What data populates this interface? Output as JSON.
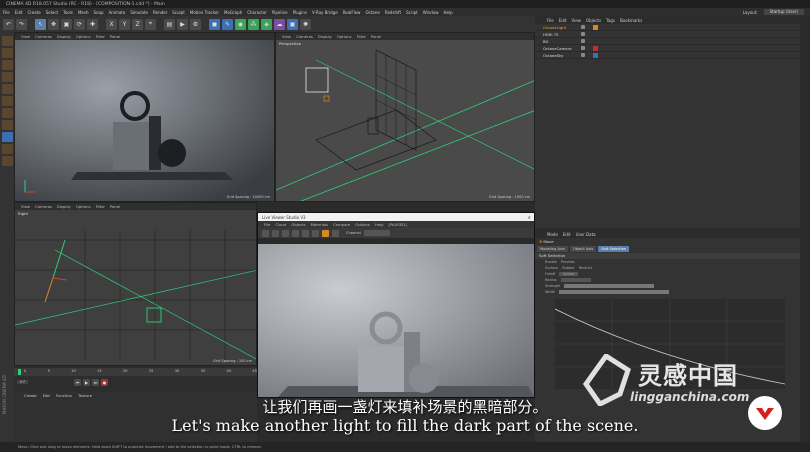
{
  "window": {
    "title": "CINEMA 4D R18.057 Studio (RC - R18) - [COMPOSITION-1.c4d *] - Main"
  },
  "menubar": {
    "items": [
      "File",
      "Edit",
      "Create",
      "Select",
      "Tools",
      "Mesh",
      "Snap",
      "Animate",
      "Simulate",
      "Render",
      "Sculpt",
      "Motion Tracker",
      "MoGraph",
      "Character",
      "Pipeline",
      "Plugins",
      "V-Ray Bridge",
      "RealFlow",
      "Octane",
      "Redshift",
      "Script",
      "Window",
      "Help"
    ],
    "layout_label": "Layout:",
    "layout_value": "Startup (User)"
  },
  "toolbar": {
    "axis_labels": [
      "X",
      "Y",
      "Z"
    ]
  },
  "viewports": {
    "menu": [
      "View",
      "Cameras",
      "Display",
      "Options",
      "Filter",
      "Panel"
    ],
    "perspective_name": "Perspective",
    "perspective2_name": "Perspective",
    "right_name": "Right",
    "grid_spacing_1": "Grid Spacing : 10000 cm",
    "grid_spacing_2": "Grid Spacing : 1000 cm",
    "grid_spacing_3": "Grid Spacing : 100 cm"
  },
  "object_manager": {
    "menu": [
      "File",
      "Edit",
      "View",
      "Objects",
      "Tags",
      "Bookmarks"
    ],
    "objects": [
      "OctaneLight",
      "HDRI 75",
      "BG",
      "OctaneCamera",
      "OctaneSky"
    ]
  },
  "attribute_manager": {
    "menu": [
      "Mode",
      "Edit",
      "User Data"
    ],
    "object_label": "Move",
    "tabs": [
      "Modeling Axis",
      "Object Axis",
      "Soft Selection"
    ],
    "section": "Soft Selection",
    "attrs": [
      "Enable",
      "Surface",
      "Rubber",
      "Restrict",
      "Falloff",
      "Radius",
      "Strength",
      "Width"
    ],
    "enable_value": "Preview",
    "falloff_value": "Linear"
  },
  "live_viewer": {
    "title": "Live Viewer Studio V3",
    "menu": [
      "File",
      "Cloud",
      "Objects",
      "Materials",
      "Compare",
      "Options",
      "Help",
      "[PAUSED]"
    ],
    "channel": "Channel"
  },
  "timeline": {
    "ticks": [
      "0",
      "5",
      "10",
      "15",
      "20",
      "25",
      "30",
      "35",
      "40",
      "45"
    ],
    "frame": "0 F"
  },
  "bottom_tabs": {
    "items": [
      "Create",
      "Edit",
      "Function",
      "Texture"
    ]
  },
  "statusbar": {
    "text": "Move: Click and drag to move elements. Hold down SHIFT to quantize movement / add to the selection in point mode, CTRL to remove."
  },
  "subtitles": {
    "cn": "让我们再画一盏灯来填补场景的黑暗部分。",
    "en": "Let's make another light to fill the dark part of the scene."
  },
  "watermark": {
    "brand": "灵感中国",
    "url": "lingganchina.com"
  },
  "brand_logo": "MAXON CINEMA 4D",
  "colors": {
    "accent": "#5b7fa8",
    "orange": "#d68a1d",
    "grid_green": "#2cd07a",
    "viewport_bg": "#3a3a3a"
  }
}
